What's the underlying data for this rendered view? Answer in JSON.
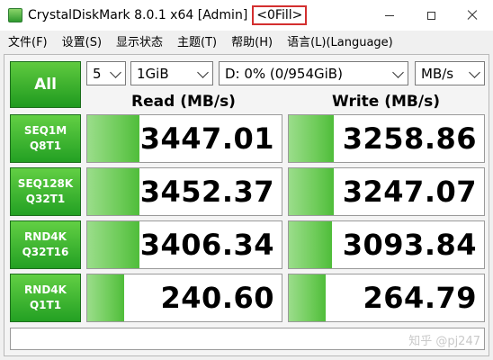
{
  "titlebar": {
    "title": "CrystalDiskMark 8.0.1 x64 [Admin]",
    "fill_tag": "<0Fill>",
    "icons": [
      "app-icon",
      "minimize-icon",
      "maximize-icon",
      "close-icon"
    ]
  },
  "menu": [
    {
      "label": "文件(F)"
    },
    {
      "label": "设置(S)"
    },
    {
      "label": "显示状态"
    },
    {
      "label": "主题(T)"
    },
    {
      "label": "帮助(H)"
    },
    {
      "label": "语言(L)(Language)"
    }
  ],
  "controls": {
    "all_label": "All",
    "count": "5",
    "size": "1GiB",
    "drive": "D: 0% (0/954GiB)",
    "unit": "MB/s"
  },
  "headers": {
    "read": "Read (MB/s)",
    "write": "Write (MB/s)"
  },
  "rows": [
    {
      "l1": "SEQ1M",
      "l2": "Q8T1",
      "read": "3447.01",
      "write": "3258.86",
      "read_fill": 0.27,
      "write_fill": 0.23
    },
    {
      "l1": "SEQ128K",
      "l2": "Q32T1",
      "read": "3452.37",
      "write": "3247.07",
      "read_fill": 0.27,
      "write_fill": 0.23
    },
    {
      "l1": "RND4K",
      "l2": "Q32T16",
      "read": "3406.34",
      "write": "3093.84",
      "read_fill": 0.27,
      "write_fill": 0.22
    },
    {
      "l1": "RND4K",
      "l2": "Q1T1",
      "read": "240.60",
      "write": "264.79",
      "read_fill": 0.19,
      "write_fill": 0.19
    }
  ],
  "status": "",
  "watermark": "知乎 @pj247",
  "colors": {
    "accent_green": "#2ea02e",
    "bar_green": "#6fcc5a",
    "tag_red": "#d32f2f"
  }
}
